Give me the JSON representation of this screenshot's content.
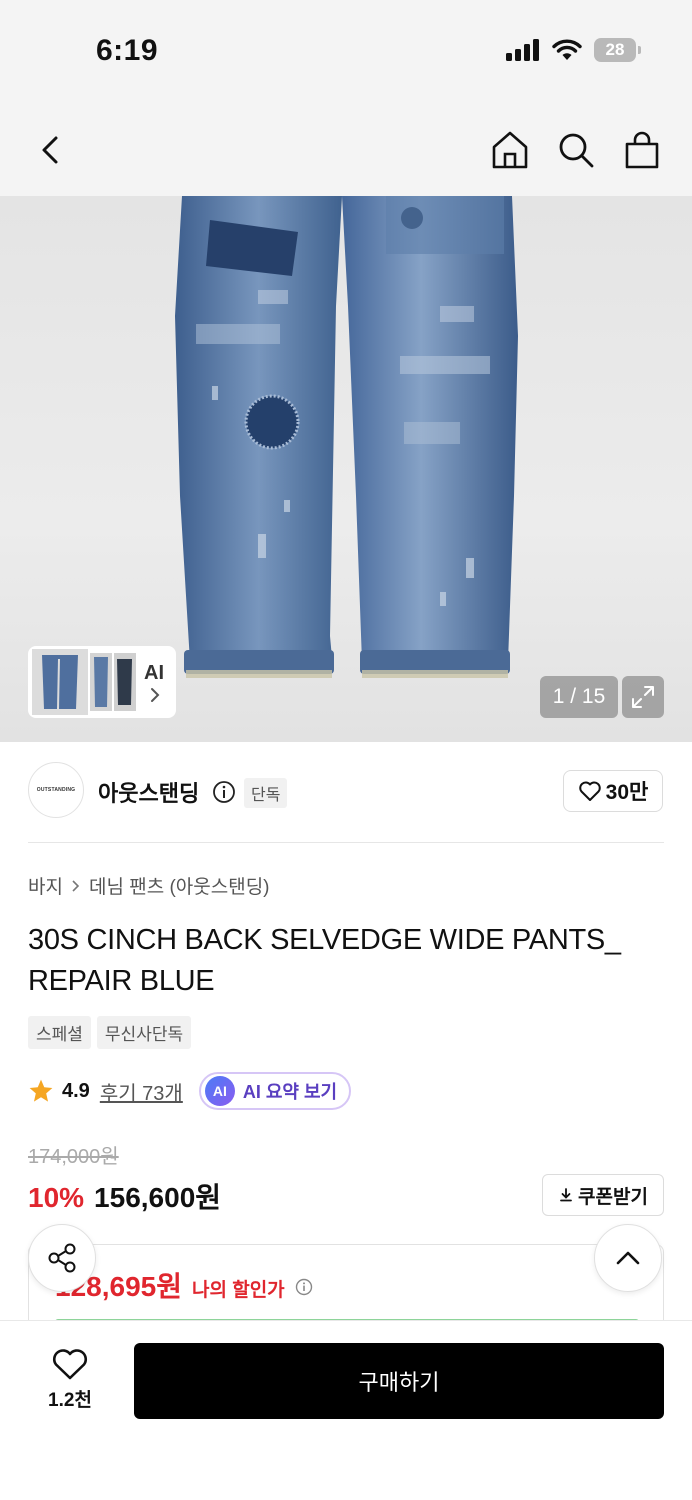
{
  "status_bar": {
    "time": "6:19",
    "battery": "28"
  },
  "nav": {
    "icons": [
      "back-icon",
      "home-icon",
      "search-icon",
      "shopping-bag-icon"
    ]
  },
  "gallery": {
    "ai_label": "AI",
    "counter": "1 / 15"
  },
  "brand": {
    "name": "아웃스탠딩",
    "logo_text": "OUTSTANDING",
    "tag": "단독",
    "likes": "30만"
  },
  "product": {
    "breadcrumb": [
      "바지",
      "데님 팬츠 (아웃스탠딩)"
    ],
    "title": "30S CINCH BACK SELVEDGE WIDE PANTS_ REPAIR BLUE",
    "tags": [
      "스페셜",
      "무신사단독"
    ]
  },
  "rating": {
    "score": "4.9",
    "reviews": "후기 73개",
    "ai_badge": "AI",
    "ai_summary": "AI 요약 보기"
  },
  "price": {
    "original": "174,000원",
    "discount": "10%",
    "sale": "156,600원",
    "coupon": "쿠폰받기",
    "my_price": "128,695원",
    "my_label": "나의 할인가"
  },
  "bottom": {
    "wish_count": "1.2천",
    "buy_label": "구매하기"
  },
  "colors": {
    "accent_red": "#e0262e",
    "ai_purple": "#5a3fc0",
    "denim": "#4a6d9c"
  }
}
